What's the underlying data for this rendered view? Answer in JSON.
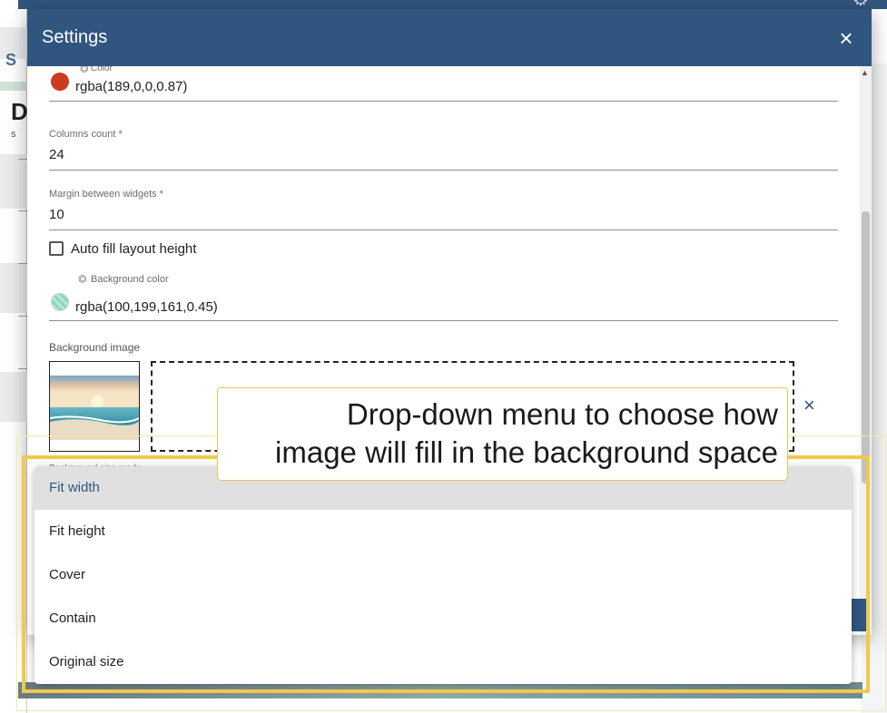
{
  "background": {
    "side_letters": [
      "S",
      "D",
      "s"
    ]
  },
  "dialog": {
    "title": "Settings",
    "close_label": "×",
    "fields": {
      "color": {
        "label": "Color",
        "value": "rgba(189,0,0,0.87)",
        "swatch": "#cb3b22"
      },
      "columns_count": {
        "label": "Columns count *",
        "value": "24"
      },
      "margin": {
        "label": "Margin between widgets *",
        "value": "10"
      },
      "auto_fill": {
        "label": "Auto fill layout height",
        "checked": false
      },
      "background_color": {
        "label": "Background color",
        "value": "rgba(100,199,161,0.45)",
        "swatch": "#8ad6bb"
      },
      "background_image": {
        "label": "Background image",
        "clear_label": "×"
      },
      "background_size_mode": {
        "label": "Background size mode"
      }
    }
  },
  "dropdown": {
    "options": [
      {
        "label": "Fit width",
        "selected": true
      },
      {
        "label": "Fit height",
        "selected": false
      },
      {
        "label": "Cover",
        "selected": false
      },
      {
        "label": "Contain",
        "selected": false
      },
      {
        "label": "Original size",
        "selected": false
      }
    ]
  },
  "annotation": {
    "line1": "Drop-down menu  to choose how",
    "line2": "image will fill in the background space",
    "highlight_color": "#f0c94b"
  },
  "colors": {
    "header": "#305680",
    "accent": "#305680"
  }
}
